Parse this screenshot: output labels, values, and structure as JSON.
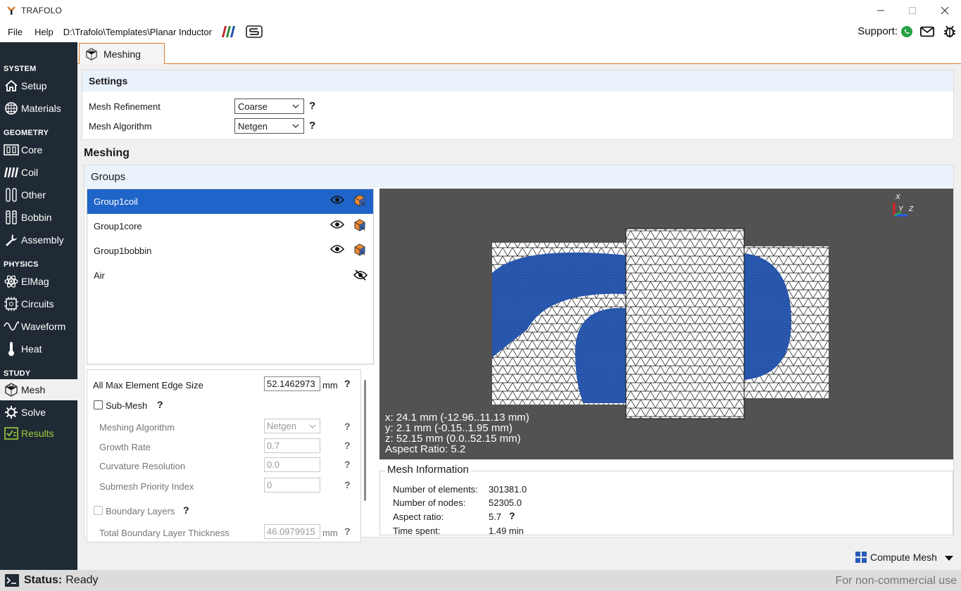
{
  "window": {
    "title": "TRAFOLO"
  },
  "menu": {
    "file": "File",
    "help": "Help",
    "path": "D:\\Trafolo\\Templates\\Planar Inductor",
    "support": "Support:"
  },
  "sidebar": {
    "sections": {
      "system": "SYSTEM",
      "geometry": "GEOMETRY",
      "physics": "PHYSICS",
      "study": "STUDY"
    },
    "items": {
      "setup": "Setup",
      "materials": "Materials",
      "core": "Core",
      "coil": "Coil",
      "other": "Other",
      "bobbin": "Bobbin",
      "assembly": "Assembly",
      "elmag": "ElMag",
      "circuits": "Circuits",
      "waveform": "Waveform",
      "heat": "Heat",
      "mesh": "Mesh",
      "solve": "Solve",
      "results": "Results"
    }
  },
  "tab": {
    "label": "Meshing"
  },
  "settings": {
    "title": "Settings",
    "mesh_refinement_label": "Mesh Refinement",
    "mesh_refinement_value": "Coarse",
    "mesh_algorithm_label": "Mesh Algorithm",
    "mesh_algorithm_value": "Netgen",
    "help": "?"
  },
  "meshing": {
    "title": "Meshing",
    "groups_title": "Groups"
  },
  "groups": [
    {
      "name": "Group1coil",
      "visible": true,
      "selected": true
    },
    {
      "name": "Group1core",
      "visible": true,
      "selected": false
    },
    {
      "name": "Group1bobbin",
      "visible": true,
      "selected": false
    },
    {
      "name": "Air",
      "visible": false,
      "selected": false
    }
  ],
  "props": {
    "max_edge_label": "All Max Element Edge Size",
    "max_edge_value": "52.1462973",
    "unit_mm": "mm",
    "submesh_label": "Sub-Mesh",
    "meshing_algorithm_label": "Meshing Algorithm",
    "meshing_algorithm_value": "Netgen",
    "growth_rate_label": "Growth Rate",
    "growth_rate_value": "0.7",
    "curvature_label": "Curvature Resolution",
    "curvature_value": "0.0",
    "priority_label": "Submesh Priority Index",
    "priority_value": "0",
    "boundary_layers_label": "Boundary Layers",
    "total_bl_label": "Total Boundary Layer Thickness",
    "total_bl_value": "46.0979915",
    "help": "?"
  },
  "viewport": {
    "axis_x": "X",
    "axis_y": "Y",
    "axis_z": "Z",
    "info_x": "x: 24.1 mm (-12.96..11.13 mm)",
    "info_y": "y: 2.1 mm (-0.15..1.95 mm)",
    "info_z": "z: 52.15 mm (0.0..52.15 mm)",
    "info_aspect": "Aspect Ratio: 5.2",
    "colors": {
      "background": "#525252",
      "coil": "#2a5cb8",
      "mesh": "#ffffff"
    }
  },
  "mesh_info": {
    "title": "Mesh Information",
    "elements_label": "Number of elements:",
    "elements_value": "301381.0",
    "nodes_label": "Number of nodes:",
    "nodes_value": "52305.0",
    "aspect_label": "Aspect ratio:",
    "aspect_value": "5.7",
    "time_label": "Time spent:",
    "time_value": "1.49 min",
    "help": "?"
  },
  "actions": {
    "compute_mesh": "Compute Mesh"
  },
  "status": {
    "label": "Status:",
    "value": "Ready",
    "license": "For non-commercial use"
  },
  "theme": {
    "sidebar_bg": "#1f2a34",
    "accent": "#e07b2a",
    "selection": "#1f64c8",
    "results_green": "#9ccc3c"
  }
}
